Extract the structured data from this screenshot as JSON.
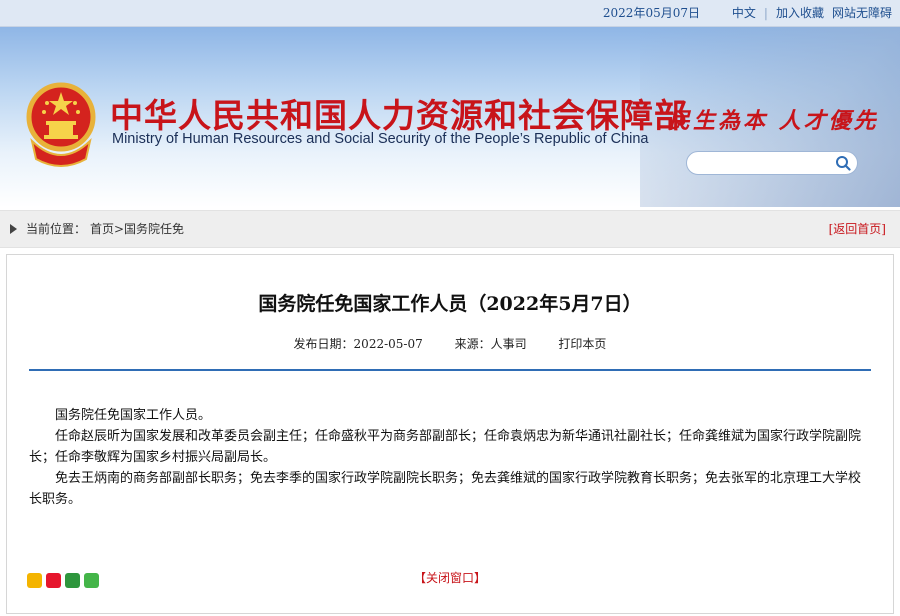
{
  "topbar": {
    "date": "2022年05月07日",
    "lang": "中文",
    "sep": "|",
    "favorite": "加入收藏",
    "accessibility": "网站无障碍"
  },
  "banner": {
    "title_cn": "中华人民共和国人力资源和社会保障部",
    "title_en": "Ministry of Human Resources and Social Security of the People’s Republic of China",
    "motto": "民生為本 人才優先",
    "search": {
      "value": "",
      "icon": "search-icon"
    }
  },
  "breadcrumb": {
    "label": "当前位置：",
    "path": "首页>国务院任免",
    "back": "[返回首页]"
  },
  "article": {
    "title": "国务院任免国家工作人员（2022年5月7日）",
    "meta": {
      "date": "发布日期：2022-05-07",
      "source": "来源：人事司",
      "print": "打印本页"
    },
    "paragraphs": [
      "国务院任免国家工作人员。",
      "任命赵辰昕为国家发展和改革委员会副主任；任命盛秋平为商务部副部长；任命袁炳忠为新华通讯社副社长；任命龚维斌为国家行政学院副院长；任命李敬辉为国家乡村振兴局副局长。",
      "免去王炳南的商务部副部长职务；免去李季的国家行政学院副院长职务；免去龚维斌的国家行政学院教育长职务；免去张军的北京理工大学校长职务。"
    ],
    "close": "【关闭窗口】"
  },
  "share_icons": [
    {
      "name": "qzone-share-icon",
      "color": "#f4b400"
    },
    {
      "name": "weibo-share-icon",
      "color": "#e6162d"
    },
    {
      "name": "douban-share-icon",
      "color": "#2e963d"
    },
    {
      "name": "wechat-share-icon",
      "color": "#44b549"
    }
  ],
  "colors": {
    "accent_red": "#c8141a",
    "accent_blue": "#2f6db5"
  }
}
